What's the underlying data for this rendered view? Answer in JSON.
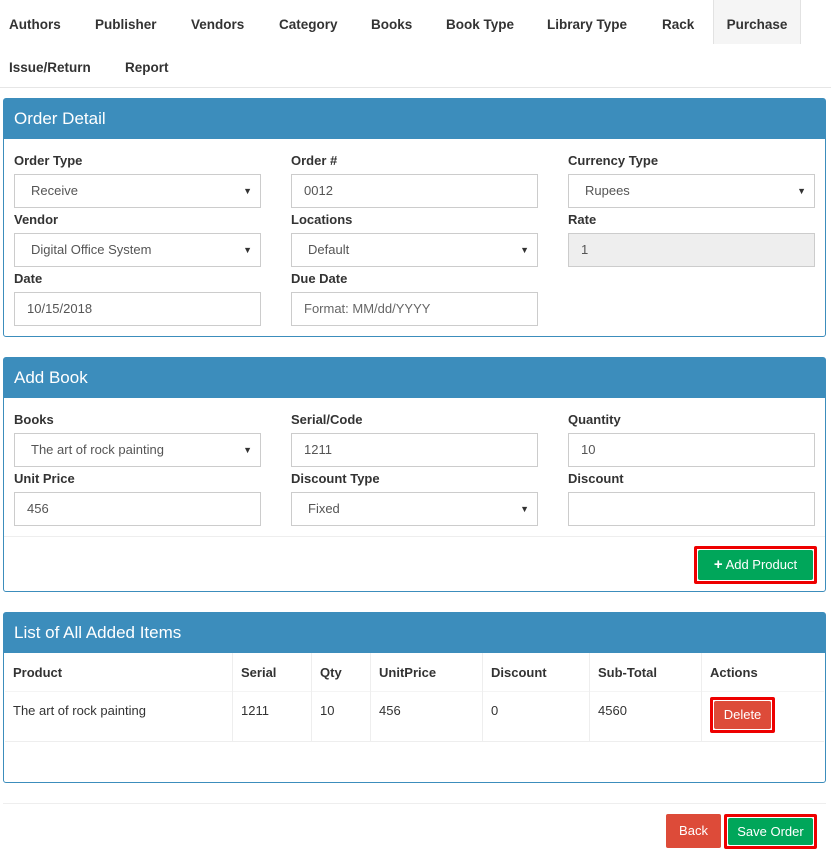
{
  "tabs": [
    {
      "label": "Authors"
    },
    {
      "label": "Publisher"
    },
    {
      "label": "Vendors"
    },
    {
      "label": "Category"
    },
    {
      "label": "Books"
    },
    {
      "label": "Book Type"
    },
    {
      "label": "Library Type"
    },
    {
      "label": "Rack"
    },
    {
      "label": "Purchase"
    },
    {
      "label": "Issue/Return"
    },
    {
      "label": "Report"
    }
  ],
  "order_detail": {
    "title": "Order Detail",
    "order_type": {
      "label": "Order Type",
      "value": "Receive"
    },
    "order_no": {
      "label": "Order #",
      "value": "0012"
    },
    "currency_type": {
      "label": "Currency Type",
      "value": "Rupees"
    },
    "vendor": {
      "label": "Vendor",
      "value": "Digital Office System"
    },
    "locations": {
      "label": "Locations",
      "value": "Default"
    },
    "rate": {
      "label": "Rate",
      "value": "1"
    },
    "date": {
      "label": "Date",
      "value": "10/15/2018"
    },
    "due_date": {
      "label": "Due Date",
      "placeholder": "Format: MM/dd/YYYY"
    }
  },
  "add_book": {
    "title": "Add Book",
    "books": {
      "label": "Books",
      "value": "The art of rock painting"
    },
    "serial": {
      "label": "Serial/Code",
      "value": "1211"
    },
    "quantity": {
      "label": "Quantity",
      "value": "10"
    },
    "unit_price": {
      "label": "Unit Price",
      "value": "456"
    },
    "discount_type": {
      "label": "Discount Type",
      "value": "Fixed"
    },
    "discount": {
      "label": "Discount",
      "value": ""
    },
    "add_product_label": "Add Product"
  },
  "items": {
    "title": "List of All Added Items",
    "headers": [
      "Product",
      "Serial",
      "Qty",
      "UnitPrice",
      "Discount",
      "Sub-Total",
      "Actions"
    ],
    "rows": [
      {
        "product": "The art of rock painting",
        "serial": "1211",
        "qty": "10",
        "unit_price": "456",
        "discount": "0",
        "subtotal": "4560",
        "action": "Delete"
      }
    ]
  },
  "footer": {
    "back_label": "Back",
    "save_label": "Save Order"
  },
  "colors": {
    "primary": "#3c8dbc",
    "success": "#00a65a",
    "danger": "#dd4b39",
    "highlight": "#ee0000"
  }
}
